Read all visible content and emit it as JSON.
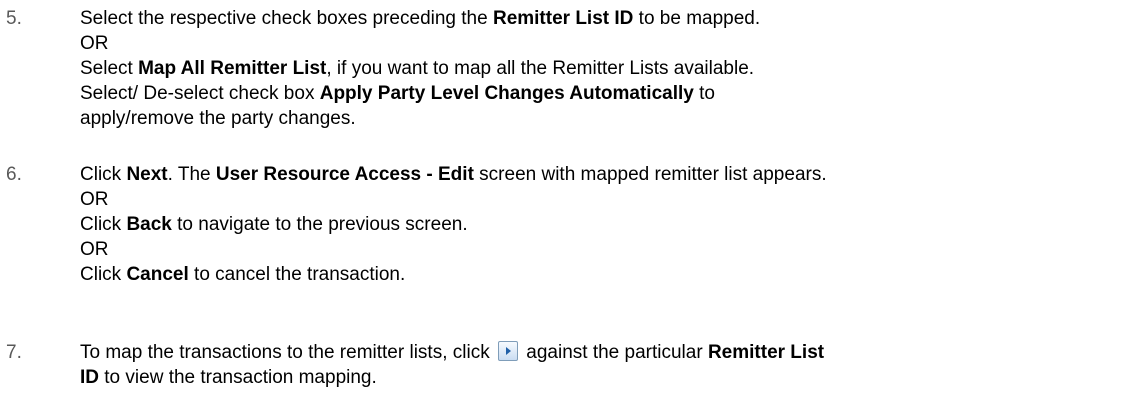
{
  "steps": [
    {
      "number": "5.",
      "lines": [
        {
          "t1": "Select the respective check boxes preceding the ",
          "b1": "Remitter List ID",
          "t2": " to be mapped."
        },
        {
          "t1": "OR"
        },
        {
          "t1": "Select ",
          "b1": "Map All Remitter List",
          "t2": ", if you want to map all the Remitter Lists available."
        },
        {
          "t1": "Select/ De-select check box ",
          "b1": "Apply Party Level Changes Automatically",
          "t2": " to"
        },
        {
          "t1": "apply/remove the party changes."
        }
      ]
    },
    {
      "number": "6.",
      "lines": [
        {
          "t1": "Click ",
          "b1": "Next",
          "t2": ". The ",
          "b2": "User Resource Access - Edit",
          "t3": " screen with mapped remitter list appears."
        },
        {
          "t1": "OR"
        },
        {
          "t1": "Click ",
          "b1": "Back",
          "t2": " to navigate to the previous screen."
        },
        {
          "t1": "OR"
        },
        {
          "t1": "Click ",
          "b1": "Cancel",
          "t2": " to cancel the transaction."
        }
      ]
    },
    {
      "number": "7.",
      "lines": [
        {
          "t1": "To map the transactions to the remitter lists, click ",
          "icon": "view-mapping-icon",
          "t2": " against the particular ",
          "b1": "Remitter List"
        },
        {
          "b1": "ID",
          "t1": " to view the transaction mapping."
        }
      ]
    }
  ],
  "colors": {
    "step_number": "#595959",
    "text": "#000000",
    "icon_arrow": "#1f5fa8"
  }
}
